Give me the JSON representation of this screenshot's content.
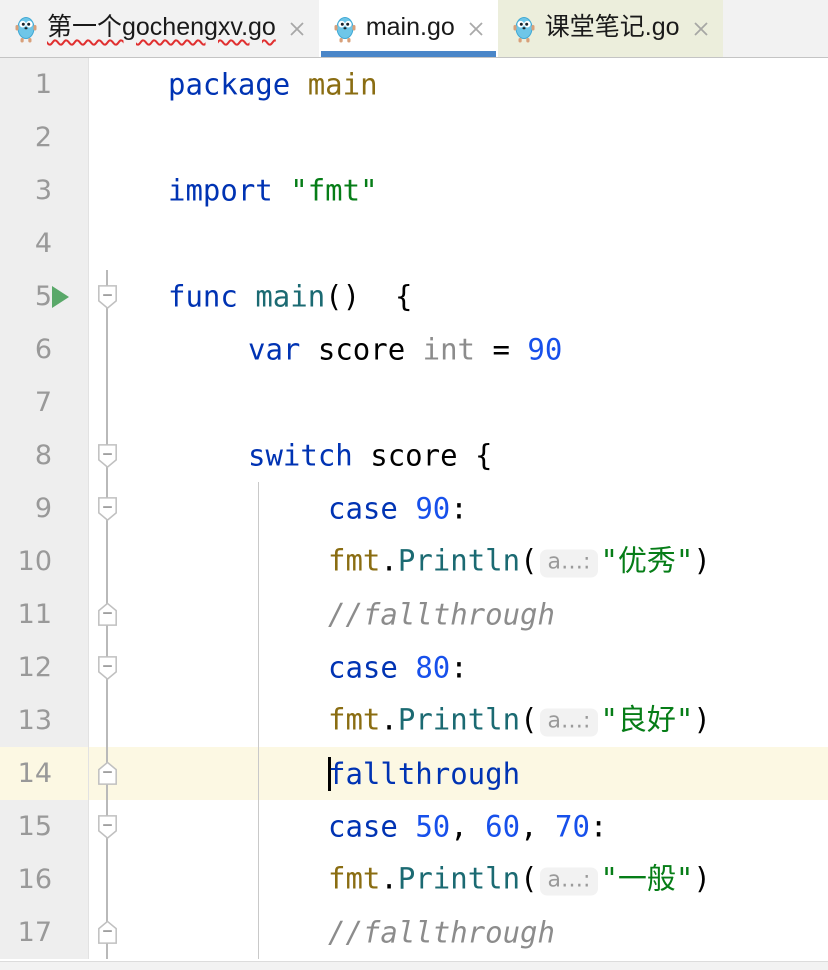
{
  "window": {
    "app": "GoLand Editor",
    "accent_blue": "#4a86c8",
    "current_line_highlight": "#fcf8e3",
    "gutter_bg": "#eeeeee"
  },
  "tabs": [
    {
      "label": "第一个gochengxv.go",
      "icon": "go-gopher-icon",
      "state": "inactive",
      "has_error_underline": true,
      "close_label": "×"
    },
    {
      "label": "main.go",
      "icon": "go-gopher-icon",
      "state": "active",
      "has_error_underline": false,
      "close_label": "×"
    },
    {
      "label": "课堂笔记.go",
      "icon": "go-gopher-icon",
      "state": "modified",
      "has_error_underline": false,
      "close_label": "×"
    }
  ],
  "editor": {
    "language": "go",
    "current_line": 14,
    "run_marker_line": 5,
    "lines": [
      {
        "num": "1",
        "tokens": [
          {
            "t": "package",
            "c": "kw"
          },
          {
            "t": " ",
            "c": "punct"
          },
          {
            "t": "main",
            "c": "pkg"
          }
        ]
      },
      {
        "num": "2",
        "tokens": []
      },
      {
        "num": "3",
        "tokens": [
          {
            "t": "import",
            "c": "kw"
          },
          {
            "t": " ",
            "c": "punct"
          },
          {
            "t": "\"fmt\"",
            "c": "str"
          }
        ]
      },
      {
        "num": "4",
        "tokens": []
      },
      {
        "num": "5",
        "fold": "start",
        "tokens": [
          {
            "t": "func",
            "c": "kw"
          },
          {
            "t": " ",
            "c": "punct"
          },
          {
            "t": "main",
            "c": "fn"
          },
          {
            "t": "()  {",
            "c": "punct"
          }
        ]
      },
      {
        "num": "6",
        "indent": 1,
        "tokens": [
          {
            "t": "var",
            "c": "kw"
          },
          {
            "t": " ",
            "c": "punct"
          },
          {
            "t": "score",
            "c": "id"
          },
          {
            "t": " ",
            "c": "punct"
          },
          {
            "t": "int",
            "c": "typ"
          },
          {
            "t": " = ",
            "c": "punct"
          },
          {
            "t": "90",
            "c": "num"
          }
        ]
      },
      {
        "num": "7",
        "tokens": []
      },
      {
        "num": "8",
        "indent": 1,
        "fold": "start",
        "tokens": [
          {
            "t": "switch",
            "c": "kw"
          },
          {
            "t": " ",
            "c": "punct"
          },
          {
            "t": "score",
            "c": "id"
          },
          {
            "t": " {",
            "c": "punct"
          }
        ]
      },
      {
        "num": "9",
        "indent": 2,
        "fold": "start",
        "tokens": [
          {
            "t": "case",
            "c": "kw"
          },
          {
            "t": " ",
            "c": "punct"
          },
          {
            "t": "90",
            "c": "num"
          },
          {
            "t": ":",
            "c": "punct"
          }
        ]
      },
      {
        "num": "10",
        "indent": 2,
        "tokens": [
          {
            "t": "fmt",
            "c": "pkg"
          },
          {
            "t": ".",
            "c": "punct"
          },
          {
            "t": "Println",
            "c": "fn"
          },
          {
            "t": "(",
            "c": "punct"
          },
          {
            "t": "a…:",
            "c": "hint"
          },
          {
            "t": "\"优秀\"",
            "c": "str"
          },
          {
            "t": ")",
            "c": "punct"
          }
        ]
      },
      {
        "num": "11",
        "indent": 2,
        "fold": "end",
        "tokens": [
          {
            "t": "//fallthrough",
            "c": "cmt"
          }
        ]
      },
      {
        "num": "12",
        "indent": 2,
        "fold": "start",
        "tokens": [
          {
            "t": "case",
            "c": "kw"
          },
          {
            "t": " ",
            "c": "punct"
          },
          {
            "t": "80",
            "c": "num"
          },
          {
            "t": ":",
            "c": "punct"
          }
        ]
      },
      {
        "num": "13",
        "indent": 2,
        "tokens": [
          {
            "t": "fmt",
            "c": "pkg"
          },
          {
            "t": ".",
            "c": "punct"
          },
          {
            "t": "Println",
            "c": "fn"
          },
          {
            "t": "(",
            "c": "punct"
          },
          {
            "t": "a…:",
            "c": "hint"
          },
          {
            "t": "\"良好\"",
            "c": "str"
          },
          {
            "t": ")",
            "c": "punct"
          }
        ]
      },
      {
        "num": "14",
        "indent": 2,
        "fold": "end",
        "caret": true,
        "tokens": [
          {
            "t": "fallthrough",
            "c": "kw"
          }
        ]
      },
      {
        "num": "15",
        "indent": 2,
        "fold": "start",
        "tokens": [
          {
            "t": "case",
            "c": "kw"
          },
          {
            "t": " ",
            "c": "punct"
          },
          {
            "t": "50",
            "c": "num"
          },
          {
            "t": ", ",
            "c": "punct"
          },
          {
            "t": "60",
            "c": "num"
          },
          {
            "t": ", ",
            "c": "punct"
          },
          {
            "t": "70",
            "c": "num"
          },
          {
            "t": ":",
            "c": "punct"
          }
        ]
      },
      {
        "num": "16",
        "indent": 2,
        "tokens": [
          {
            "t": "fmt",
            "c": "pkg"
          },
          {
            "t": ".",
            "c": "punct"
          },
          {
            "t": "Println",
            "c": "fn"
          },
          {
            "t": "(",
            "c": "punct"
          },
          {
            "t": "a…:",
            "c": "hint"
          },
          {
            "t": "\"一般\"",
            "c": "str"
          },
          {
            "t": ")",
            "c": "punct"
          }
        ]
      },
      {
        "num": "17",
        "indent": 2,
        "fold": "end",
        "clipped": true,
        "tokens": [
          {
            "t": "//fallthrough",
            "c": "cmt"
          }
        ]
      }
    ]
  }
}
